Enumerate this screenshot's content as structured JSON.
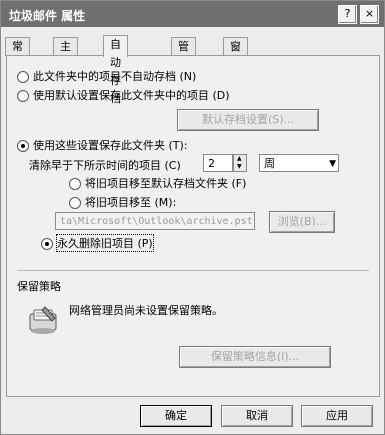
{
  "window": {
    "title": "垃圾邮件 属性",
    "help_glyph": "?",
    "close_glyph": "×"
  },
  "tabs": [
    "常规",
    "主页",
    "自动存档",
    "管理",
    "窗体"
  ],
  "options": {
    "no_archive": "此文件夹中的项目不自动存档 (N)",
    "use_default": "使用默认设置保存此文件夹中的项目 (D)",
    "default_button": "默认存档设置(S)...",
    "use_these": "使用这些设置保存此文件夹 (T):",
    "clean_older": "清除早于下所示时间的项目 (C)",
    "age_value": "2",
    "age_unit": "周",
    "move_default": "将旧项目移至默认存档文件夹 (F)",
    "move_to": "将旧项目移至 (M):",
    "path_value": "ta\\Microsoft\\Outlook\\archive.pst",
    "browse_button": "浏览(B)...",
    "delete_permanently": "永久删除旧项目 (P)"
  },
  "retention": {
    "header": "保留策略",
    "message": "网络管理员尚未设置保留策略。",
    "info_button": "保留策略信息(I)..."
  },
  "footer": {
    "ok": "确定",
    "cancel": "取消",
    "apply": "应用"
  }
}
